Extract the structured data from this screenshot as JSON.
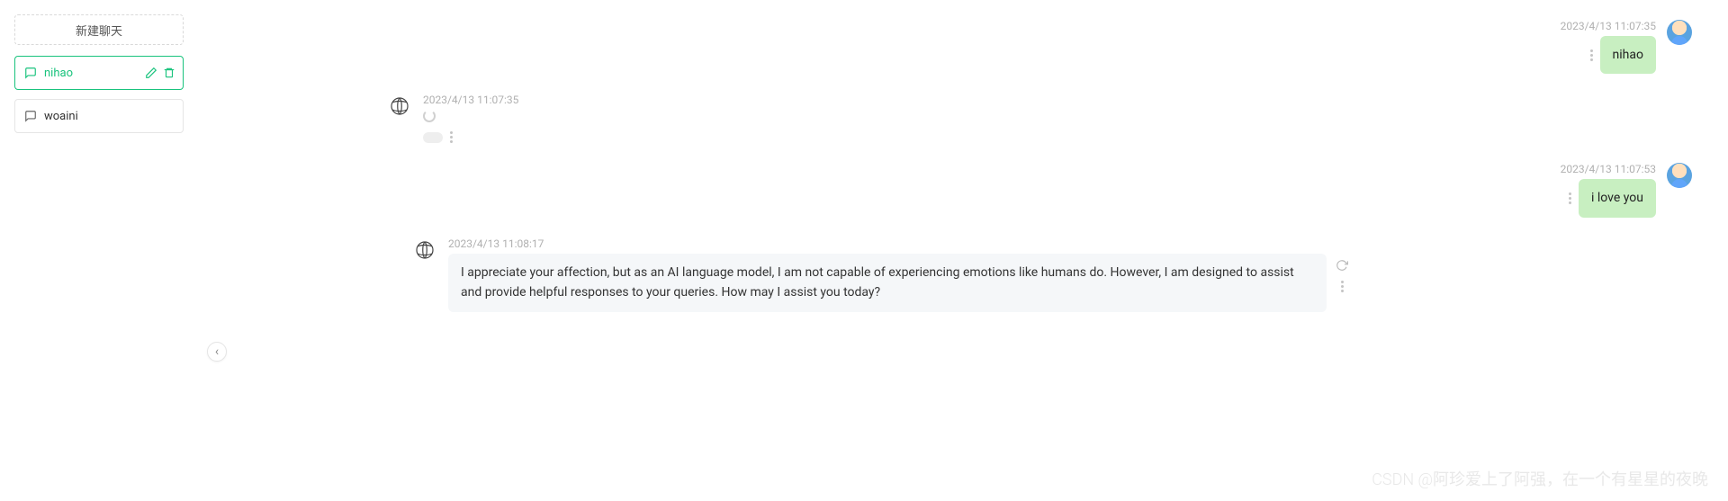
{
  "sidebar": {
    "new_chat_label": "新建聊天",
    "chats": [
      {
        "label": "nihao",
        "active": true
      },
      {
        "label": "woaini",
        "active": false
      }
    ]
  },
  "collapse_glyph": "‹",
  "messages": [
    {
      "role": "user",
      "timestamp": "2023/4/13 11:07:35",
      "text": "nihao"
    },
    {
      "role": "bot",
      "timestamp": "2023/4/13 11:07:35",
      "loading": true
    },
    {
      "role": "user",
      "timestamp": "2023/4/13 11:07:53",
      "text": "i love you"
    },
    {
      "role": "bot",
      "timestamp": "2023/4/13 11:08:17",
      "text": "I appreciate your affection, but as an AI language model, I am not capable of experiencing emotions like humans do. However, I am designed to assist and provide helpful responses to your queries. How may I assist you today?"
    }
  ],
  "watermark": "CSDN @阿珍爱上了阿强，在一个有星星的夜晚"
}
